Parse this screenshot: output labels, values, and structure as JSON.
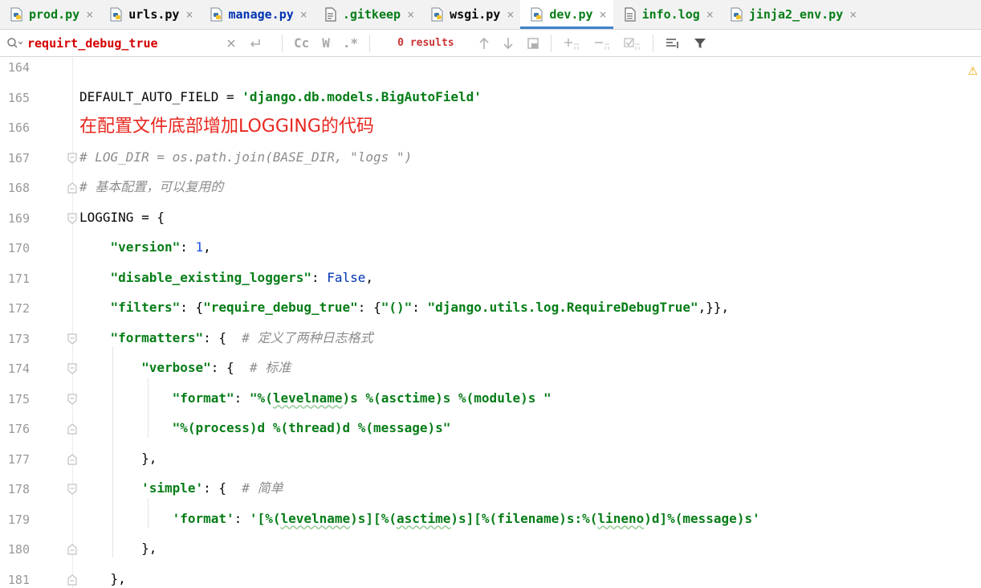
{
  "tabs": [
    {
      "label": "prod.py",
      "icon": "python-file-icon",
      "color": "#067d17",
      "active": false
    },
    {
      "label": "urls.py",
      "icon": "python-file-icon",
      "color": "#080808",
      "active": false
    },
    {
      "label": "manage.py",
      "icon": "python-file-icon",
      "color": "#0033b3",
      "active": false
    },
    {
      "label": ".gitkeep",
      "icon": "text-file-icon",
      "color": "#067d17",
      "active": false
    },
    {
      "label": "wsgi.py",
      "icon": "python-file-icon",
      "color": "#080808",
      "active": false
    },
    {
      "label": "dev.py",
      "icon": "python-file-icon",
      "color": "#067d17",
      "active": true
    },
    {
      "label": "info.log",
      "icon": "log-file-icon",
      "color": "#067d17",
      "active": false
    },
    {
      "label": "jinja2_env.py",
      "icon": "python-file-icon",
      "color": "#067d17",
      "active": false
    }
  ],
  "tab_close_glyph": "×",
  "search": {
    "value": "requirt_debug_true",
    "results_text": "0 results",
    "match_case_label": "Cc",
    "words_label": "W",
    "regex_label": ".*"
  },
  "editor": {
    "warning_glyph": "⚠",
    "lines": [
      {
        "num": "164",
        "segments": [],
        "fold": false
      },
      {
        "num": "165",
        "segments": [
          {
            "t": "DEFAULT_AUTO_FIELD = ",
            "c": ""
          },
          {
            "t": "'django.db.models.BigAutoField'",
            "c": "str"
          }
        ],
        "fold": false
      },
      {
        "num": "166",
        "segments": [
          {
            "t": "在配置文件底部增加LOGGING的代码",
            "c": "annot"
          }
        ],
        "fold": false
      },
      {
        "num": "167",
        "segments": [
          {
            "t": "# LOG_DIR = os.path.join(BASE_DIR, \"logs \")",
            "c": "cmt"
          }
        ],
        "fold": "open"
      },
      {
        "num": "168",
        "segments": [
          {
            "t": "# 基本配置，可以复用的",
            "c": "cmt"
          }
        ],
        "fold": "close"
      },
      {
        "num": "169",
        "segments": [
          {
            "t": "LOGGING = {",
            "c": ""
          }
        ],
        "fold": "open"
      },
      {
        "num": "170",
        "segments": [
          {
            "t": "    ",
            "c": ""
          },
          {
            "t": "\"version\"",
            "c": "str"
          },
          {
            "t": ": ",
            "c": ""
          },
          {
            "t": "1",
            "c": "num"
          },
          {
            "t": ",",
            "c": ""
          }
        ],
        "fold": false
      },
      {
        "num": "171",
        "segments": [
          {
            "t": "    ",
            "c": ""
          },
          {
            "t": "\"disable_existing_loggers\"",
            "c": "str"
          },
          {
            "t": ": ",
            "c": ""
          },
          {
            "t": "False",
            "c": "kw"
          },
          {
            "t": ",",
            "c": ""
          }
        ],
        "fold": false
      },
      {
        "num": "172",
        "segments": [
          {
            "t": "    ",
            "c": ""
          },
          {
            "t": "\"filters\"",
            "c": "str"
          },
          {
            "t": ": {",
            "c": ""
          },
          {
            "t": "\"require_debug_true\"",
            "c": "str"
          },
          {
            "t": ": {",
            "c": ""
          },
          {
            "t": "\"()\"",
            "c": "str"
          },
          {
            "t": ": ",
            "c": ""
          },
          {
            "t": "\"django.utils.log.RequireDebugTrue\"",
            "c": "str"
          },
          {
            "t": ",}},",
            "c": ""
          }
        ],
        "fold": false
      },
      {
        "num": "173",
        "segments": [
          {
            "t": "    ",
            "c": ""
          },
          {
            "t": "\"formatters\"",
            "c": "str"
          },
          {
            "t": ": {  ",
            "c": ""
          },
          {
            "t": "# 定义了两种日志格式",
            "c": "cmt"
          }
        ],
        "fold": "open"
      },
      {
        "num": "174",
        "segments": [
          {
            "t": "        ",
            "c": ""
          },
          {
            "t": "\"verbose\"",
            "c": "str"
          },
          {
            "t": ": {  ",
            "c": ""
          },
          {
            "t": "# 标准",
            "c": "cmt"
          }
        ],
        "fold": "open"
      },
      {
        "num": "175",
        "segments": [
          {
            "t": "            ",
            "c": ""
          },
          {
            "t": "\"format\"",
            "c": "str"
          },
          {
            "t": ": ",
            "c": ""
          },
          {
            "t": "\"%(",
            "c": "str"
          },
          {
            "t": "levelname",
            "c": "str wavy"
          },
          {
            "t": ")s %(asctime)s %(module)s \"",
            "c": "str"
          }
        ],
        "fold": "open"
      },
      {
        "num": "176",
        "segments": [
          {
            "t": "            ",
            "c": ""
          },
          {
            "t": "\"%(process)d %(thread)d %(message)s\"",
            "c": "str"
          }
        ],
        "fold": "close"
      },
      {
        "num": "177",
        "segments": [
          {
            "t": "        },",
            "c": ""
          }
        ],
        "fold": "close"
      },
      {
        "num": "178",
        "segments": [
          {
            "t": "        ",
            "c": ""
          },
          {
            "t": "'simple'",
            "c": "str"
          },
          {
            "t": ": {  ",
            "c": ""
          },
          {
            "t": "# 简单",
            "c": "cmt"
          }
        ],
        "fold": "open"
      },
      {
        "num": "179",
        "segments": [
          {
            "t": "            ",
            "c": ""
          },
          {
            "t": "'format'",
            "c": "str"
          },
          {
            "t": ": ",
            "c": ""
          },
          {
            "t": "'[%(",
            "c": "str"
          },
          {
            "t": "levelname",
            "c": "str wavy"
          },
          {
            "t": ")s][%(",
            "c": "str"
          },
          {
            "t": "asctime",
            "c": "str wavy"
          },
          {
            "t": ")s][%(filename)s:%(",
            "c": "str"
          },
          {
            "t": "lineno",
            "c": "str wavy"
          },
          {
            "t": ")d]%(message)s'",
            "c": "str"
          }
        ],
        "fold": false
      },
      {
        "num": "180",
        "segments": [
          {
            "t": "        },",
            "c": ""
          }
        ],
        "fold": "close"
      },
      {
        "num": "181",
        "segments": [
          {
            "t": "    },",
            "c": ""
          }
        ],
        "fold": "close"
      }
    ]
  }
}
